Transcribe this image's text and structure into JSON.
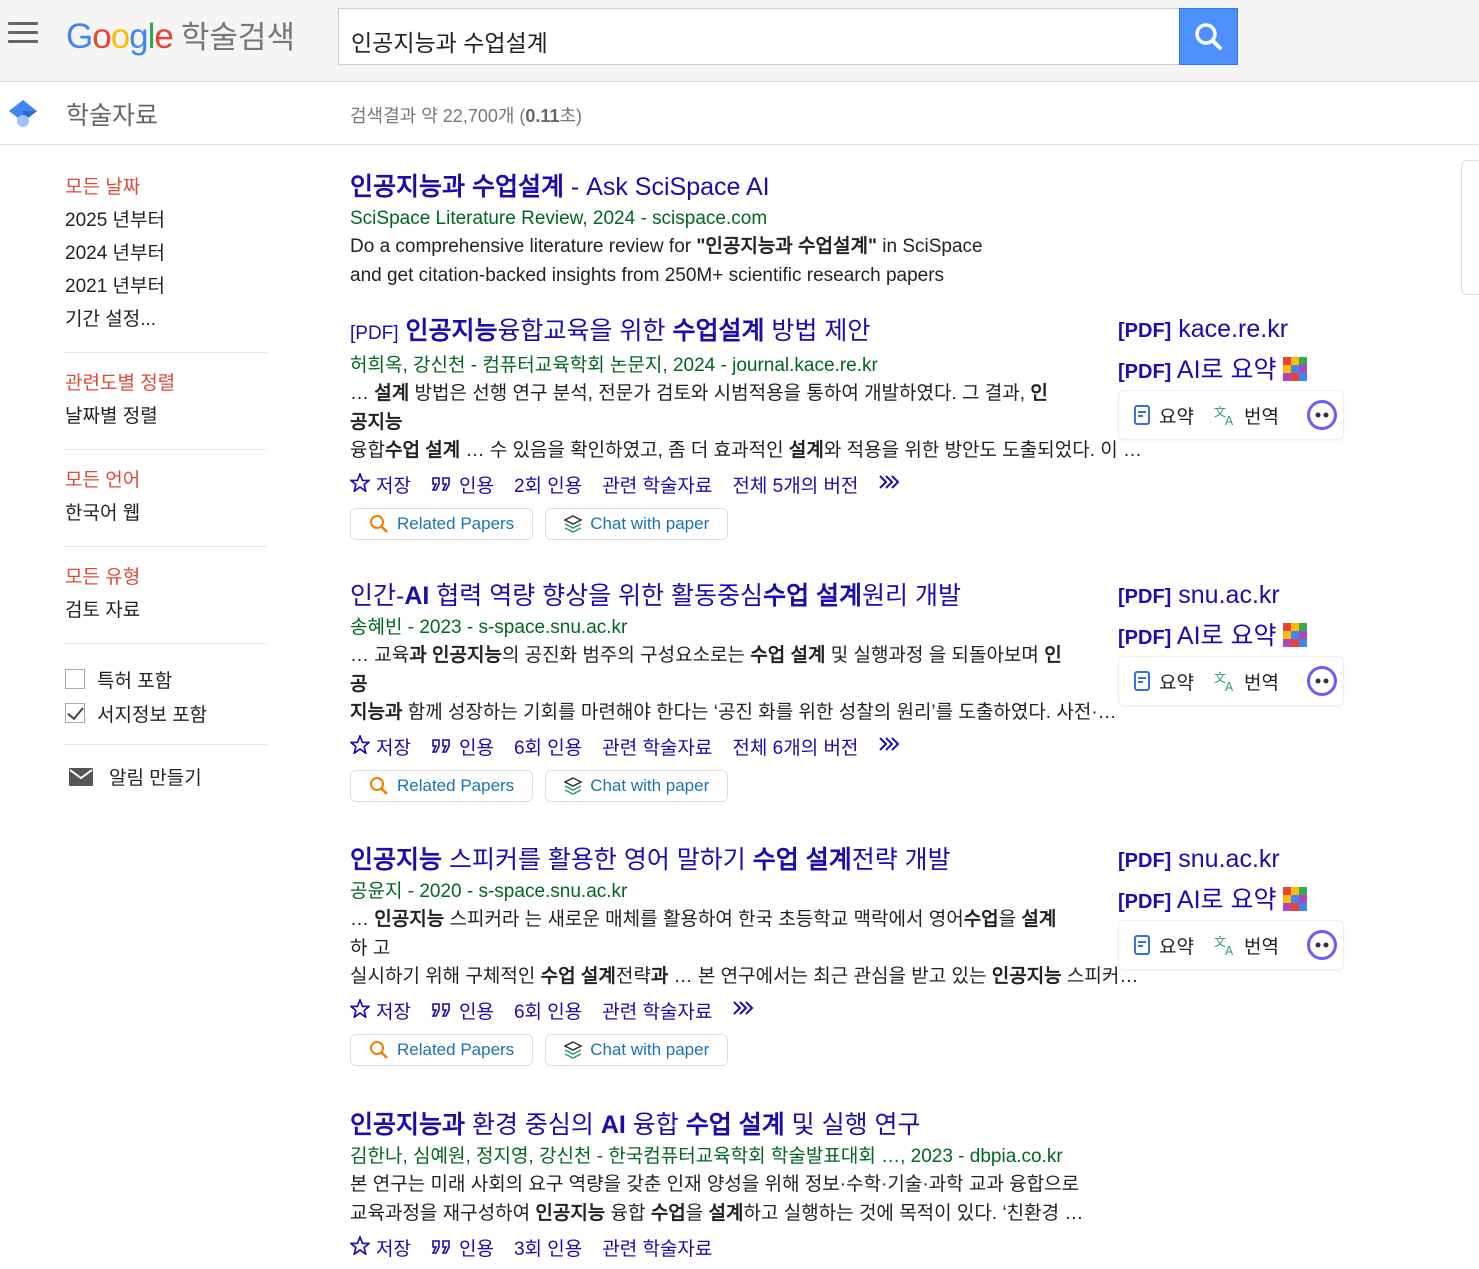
{
  "header": {
    "logo_letters": [
      "G",
      "o",
      "o",
      "g",
      "l",
      "e"
    ],
    "logo_suffix": "학술검색",
    "search_query": "인공지능과 수업설계"
  },
  "subheader": {
    "title": "학술자료",
    "count_prefix": "검색결과 약 22,700개 (",
    "time": "0.11",
    "count_suffix": "초)"
  },
  "sidebar": {
    "date_items": [
      "모든 날짜",
      "2025 년부터",
      "2024 년부터",
      "2021 년부터",
      "기간 설정..."
    ],
    "sort_items": [
      "관련도별 정렬",
      "날짜별 정렬"
    ],
    "lang_items": [
      "모든 언어",
      "한국어 웹"
    ],
    "type_items": [
      "모든 유형",
      "검토 자료"
    ],
    "checkboxes": [
      {
        "label": "특허 포함",
        "checked": false
      },
      {
        "label": "서지정보 포함",
        "checked": true
      }
    ],
    "alert_label": "알림 만들기"
  },
  "results": [
    {
      "title_html": "<b>인공지능과 수업설계</b> - Ask SciSpace AI",
      "meta": "SciSpace Literature Review, 2024 - scispace.com",
      "snippet_html": "Do a comprehensive literature review for <b>\"인공지능과 수업설계\"</b> in SciSpace<br>and get citation-backed insights from 250M+ scientific research papers"
    },
    {
      "tag": "[PDF]",
      "title_html": " <b>인공지능</b>융합교육을 위한 <b>수업설계</b> 방법 제안",
      "meta": "허희옥,  강신천 - 컴퓨터교육학회 논문지, 2024 - journal.kace.re.kr",
      "snippet_html": "… <b>설계</b> 방법은 선행 연구 분석, 전문가 검토와 시범적용을 통하여 개발하였다. 그 결과, <b>인<br>공지능</b><br>융합<b>수업 설계</b> … 수 있음을 확인하였고, 좀 더 효과적인 <b>설계</b>와 적용을 위한 방안도 도출되었다. 이 …",
      "links": [
        "저장",
        "인용",
        "2회 인용",
        "관련 학술자료",
        "전체 5개의 버전"
      ],
      "right": {
        "pdf_label": "[PDF]",
        "domain": "kace.re.kr",
        "ai_label": "AI로 요약"
      }
    },
    {
      "title_html": "인간-<b>AI</b> 협력 역량 향상을 위한 활동중심<b>수업 설계</b>원리 개발",
      "meta": "송혜빈 - 2023 - s-space.snu.ac.kr",
      "snippet_html": "… 교육<b>과 인공지능</b>의 공진화 범주의 구성요소로는 <b>수업 설계</b> 및 실행과정 을 되돌아보며 <b>인<br>공</b><br><b>지능과</b> 함께 성장하는 기회를 마련해야 한다는 ‘공진 화를 위한 성찰의 원리’를 도출하였다. 사전·…",
      "links": [
        "저장",
        "인용",
        "6회 인용",
        "관련 학술자료",
        "전체 6개의 버전"
      ],
      "right": {
        "pdf_label": "[PDF]",
        "domain": "snu.ac.kr",
        "ai_label": "AI로 요약"
      }
    },
    {
      "title_html": "<b>인공지능</b> 스피커를 활용한 영어 말하기 <b>수업 설계</b>전략 개발",
      "meta": "공윤지 - 2020 - s-space.snu.ac.kr",
      "snippet_html": "… <b>인공지능</b> 스피커라 는 새로운 매체를 활용하여 한국 초등학교 맥락에서 영어<b>수업</b>을 <b>설계</b><br>하 고<br>실시하기 위해 구체적인 <b>수업 설계</b>전략<b>과</b> … 본 연구에서는 최근 관심을 받고 있는 <b>인공지능</b> 스피커…",
      "links": [
        "저장",
        "인용",
        "6회 인용",
        "관련 학술자료"
      ],
      "right": {
        "pdf_label": "[PDF]",
        "domain": "snu.ac.kr",
        "ai_label": "AI로 요약"
      }
    },
    {
      "title_html": "<b>인공지능과</b> 환경 중심의 <b>AI</b> 융합 <b>수업 설계</b> 및 실행 연구",
      "meta": "김한나,  심예원,  정지영,  강신천 - 한국컴퓨터교육학회 학술발표대회 …, 2023 - dbpia.co.kr",
      "snippet_html": "본 연구는 미래 사회의 요구 역량을 갖춘 인재 양성을 위해 정보·수학·기술·과학 교과 융합으로<br>교육과정을 재구성하여 <b>인공지능</b> 융합 <b>수업</b>을 <b>설계</b>하고 실행하는 것에 목적이 있다. ‘친환경 …",
      "links": [
        "저장",
        "인용",
        "3회 인용",
        "관련 학술자료"
      ]
    }
  ],
  "plugin": {
    "related_label": "Related Papers",
    "chat_label": "Chat with paper"
  },
  "tools": {
    "summary_label": "요약",
    "translate_label": "번역"
  },
  "colors": {
    "link": "#1a0dab",
    "meta": "#006621",
    "red": "#dd4b39",
    "search_btn": "#4d90fe"
  }
}
